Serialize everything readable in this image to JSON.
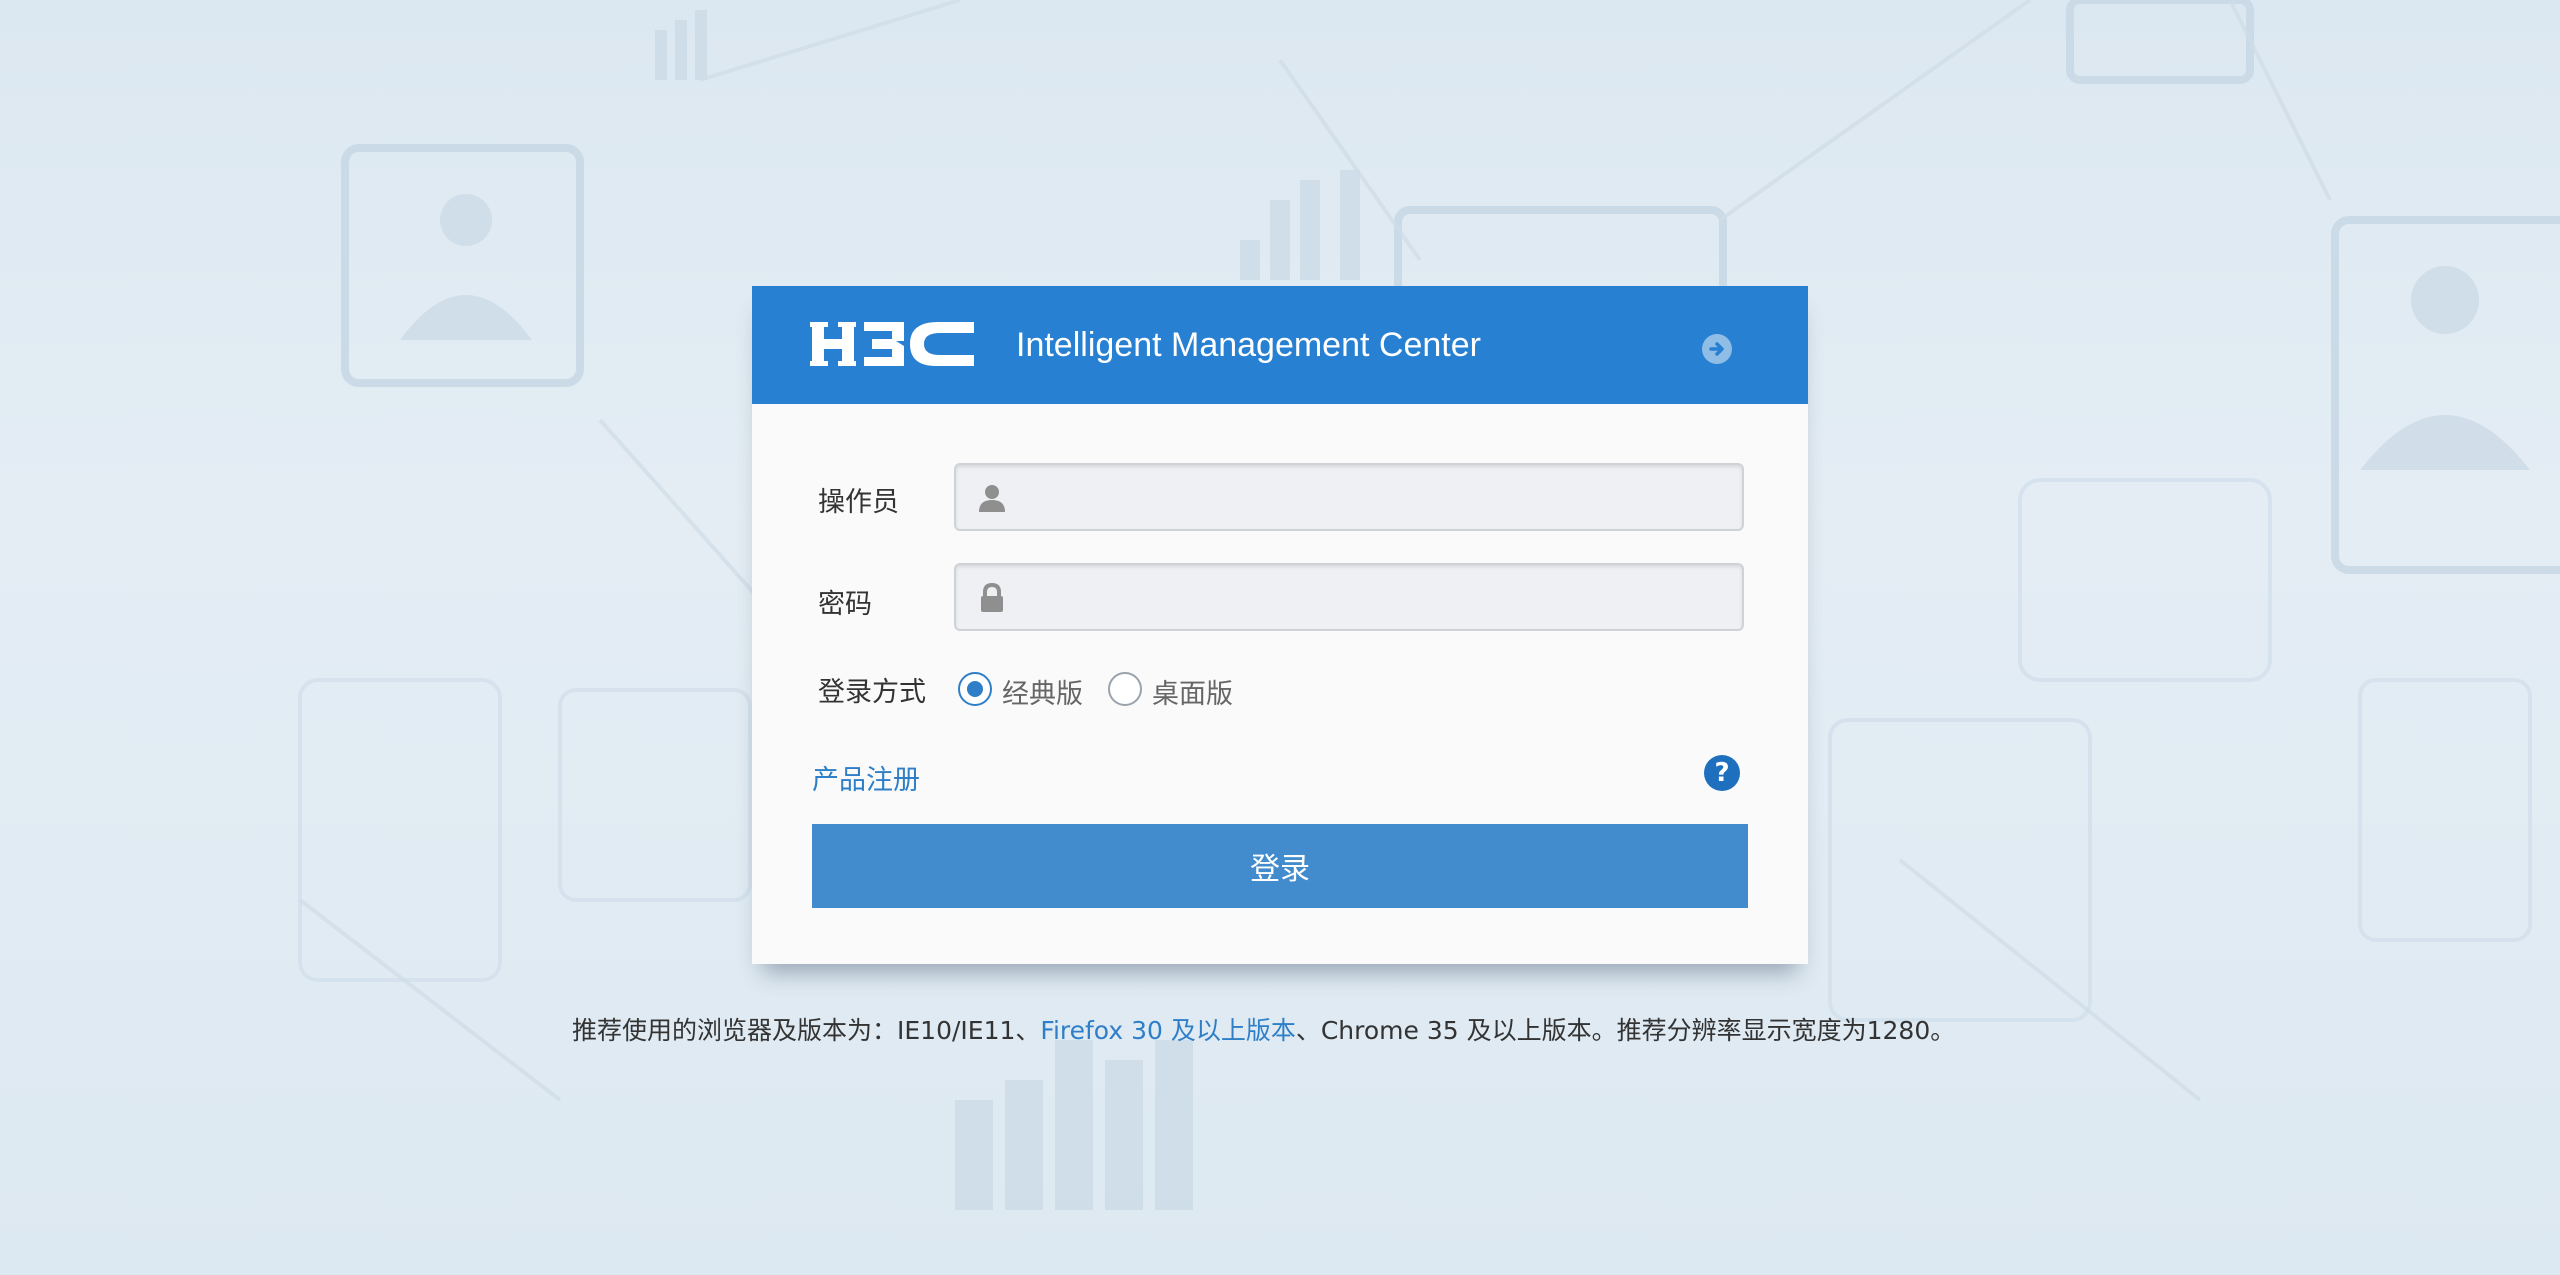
{
  "header": {
    "logo_text": "H3C",
    "title": "Intelligent Management Center"
  },
  "form": {
    "operator_label": "操作员",
    "operator_value": "",
    "password_label": "密码",
    "password_value": "",
    "login_mode_label": "登录方式",
    "login_modes": [
      {
        "label": "经典版",
        "checked": true
      },
      {
        "label": "桌面版",
        "checked": false
      }
    ],
    "register_link": "产品注册",
    "help_symbol": "?",
    "login_button": "登录"
  },
  "footer": {
    "part1": "推荐使用的浏览器及版本为：IE10/IE11、",
    "firefox_link": "Firefox 30 及以上版本",
    "part2": "、Chrome 35 及以上版本。推荐分辨率显示宽度为1280。"
  },
  "icons": {
    "user": "user-icon",
    "lock": "lock-icon",
    "arrow": "arrow-right-circle-icon",
    "help": "question-circle-icon"
  },
  "colors": {
    "header_bg": "#2780d1",
    "button_bg": "#428cce",
    "link": "#2f7fc8",
    "page_bg": "#dce8f1"
  }
}
